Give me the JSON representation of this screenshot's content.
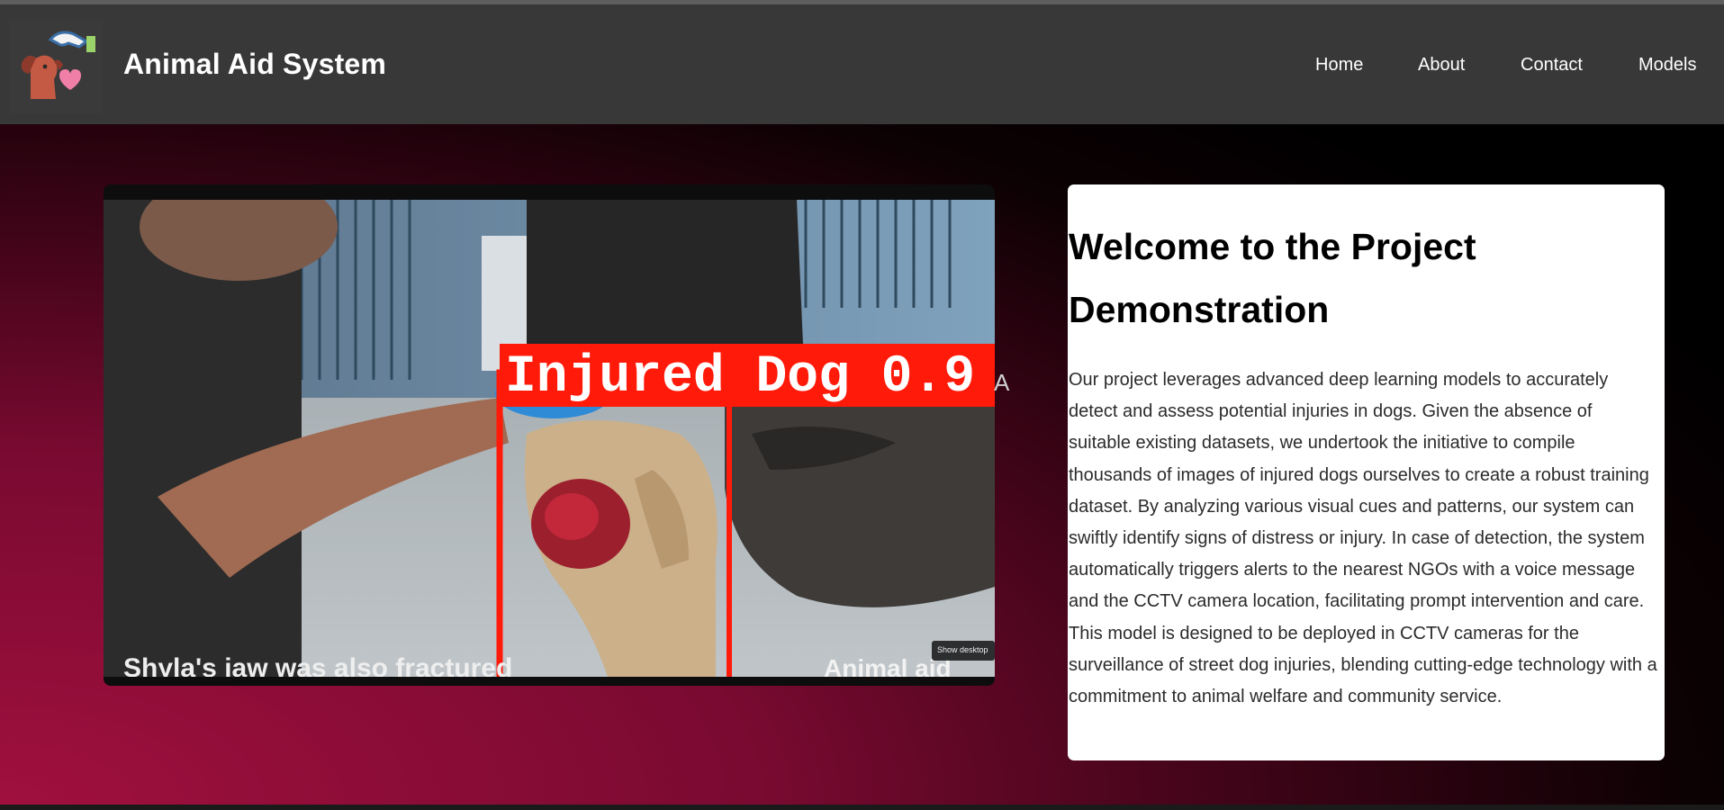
{
  "navbar": {
    "logo_icon": "animal-care-hand-heart-icon",
    "brand": "Animal Aid System",
    "links": [
      {
        "label": "Home"
      },
      {
        "label": "About"
      },
      {
        "label": "Contact"
      },
      {
        "label": "Models"
      }
    ]
  },
  "video": {
    "detection_label": "Injured Dog 0.9",
    "caption_left": "Shyla's jaw was also fractured",
    "caption_right": "Animal aid",
    "overlay_button": "Show desktop",
    "stray_char": "A"
  },
  "info": {
    "title": "Welcome to the Project Demonstration",
    "body": "Our project leverages advanced deep learning models to accurately detect and assess potential injuries in dogs. Given the absence of suitable existing datasets, we undertook the initiative to compile thousands of images of injured dogs ourselves to create a robust training dataset. By analyzing various visual cues and patterns, our system can swiftly identify signs of distress or injury. In case of detection, the system automatically triggers alerts to the nearest NGOs with a voice message and the CCTV camera location, facilitating prompt intervention and care. This model is designed to be deployed in CCTV cameras for the surveillance of street dog injuries, blending cutting-edge technology with a commitment to animal welfare and community service."
  },
  "colors": {
    "navbar_bg": "#383838",
    "accent_red": "#ff1a0a",
    "gradient_magenta": "#a0103e"
  }
}
